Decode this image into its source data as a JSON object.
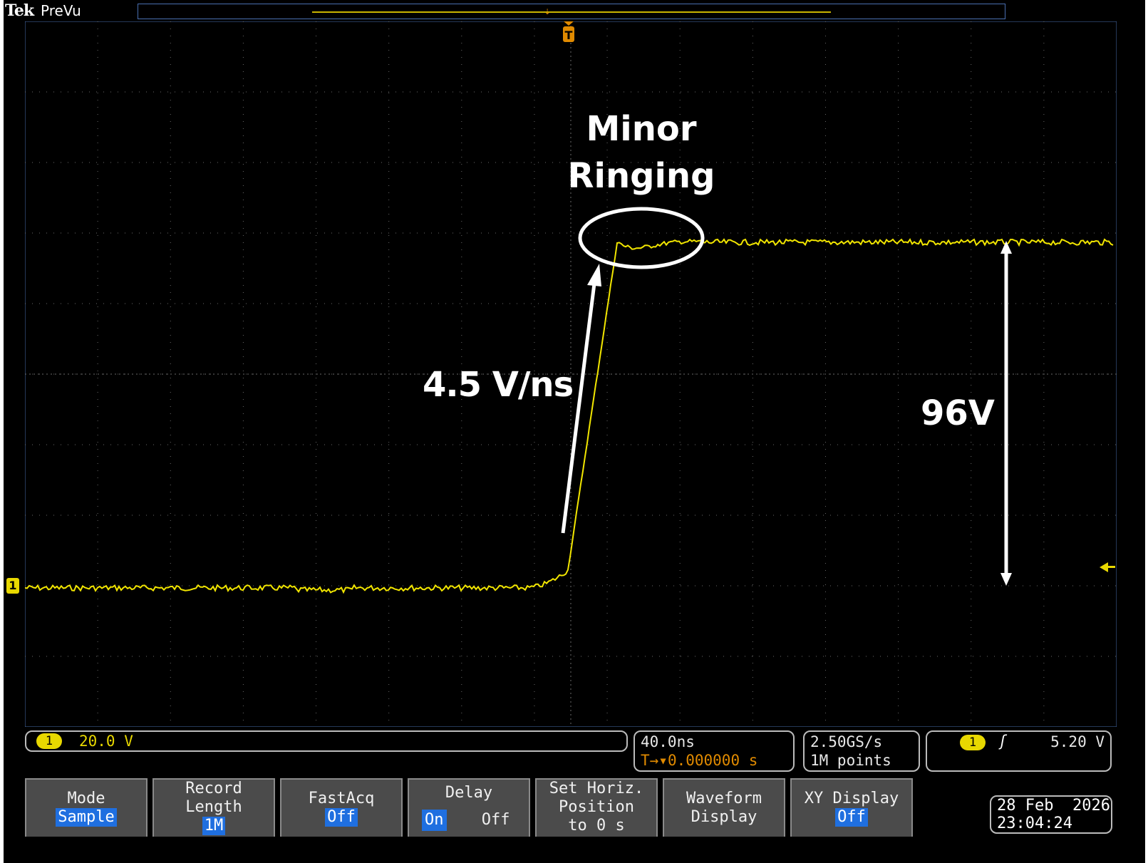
{
  "header": {
    "brand": "Tek",
    "mode": "PreVu"
  },
  "annotations": {
    "ringing_line1": "Minor",
    "ringing_line2": "Ringing",
    "slew_rate": "4.5 V/ns",
    "amplitude": "96V"
  },
  "channel": {
    "number": "1",
    "scale": "20.0 V"
  },
  "horizontal": {
    "scale": "40.0ns",
    "delay": "0.000000 s"
  },
  "acquisition": {
    "sample_rate": "2.50GS/s",
    "record_points": "1M points"
  },
  "trigger": {
    "source": "1",
    "level": "5.20 V"
  },
  "softkeys": {
    "mode_label": "Mode",
    "mode_value": "Sample",
    "record_label1": "Record",
    "record_label2": "Length",
    "record_value": "1M",
    "fastacq_label": "FastAcq",
    "fastacq_value": "Off",
    "delay_label": "Delay",
    "delay_on": "On",
    "delay_off": "Off",
    "horiz_label1": "Set Horiz.",
    "horiz_label2": "Position",
    "horiz_label3": "to 0 s",
    "waveform_label1": "Waveform",
    "waveform_label2": "Display",
    "xy_label": "XY Display",
    "xy_value": "Off"
  },
  "datetime": {
    "date": "28 Feb  2026",
    "time": "23:04:24"
  },
  "colors": {
    "trace": "#f2e600",
    "grid": "#6a6a6a",
    "trigger_marker": "#e08a00",
    "selected_key": "#1f6fe0"
  }
}
